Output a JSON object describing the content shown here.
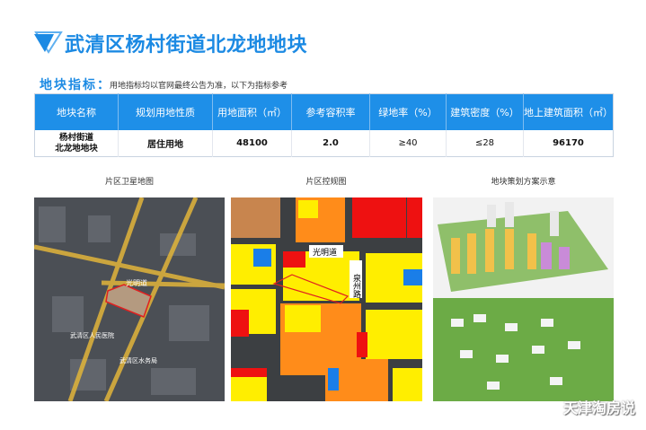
{
  "header": {
    "title": "武清区杨村街道北龙地地块",
    "section_label": "地块指标：",
    "section_note": "用地指标均以官网最终公告为准，以下为指标参考"
  },
  "table": {
    "columns": [
      "地块名称",
      "规划用地性质",
      "用地面积（㎡）",
      "参考容积率",
      "绿地率（%）",
      "建筑密度（%）",
      "地上建筑面积（㎡）"
    ],
    "rows": [
      {
        "name_line1": "杨村街道",
        "name_line2": "北龙地地块",
        "use": "居住用地",
        "area": "48100",
        "far": "2.0",
        "green": "≥40",
        "density": "≤28",
        "gfa": "96170"
      }
    ]
  },
  "images": {
    "satellite": {
      "caption": "片区卫星地图",
      "labels": {
        "road": "光明道",
        "poi1": "武清区人民医院",
        "poi2": "武清区水务局"
      }
    },
    "zoning": {
      "caption": "片区控规图",
      "labels": {
        "road1": "光明道",
        "road2": "泉州路"
      }
    },
    "plan": {
      "caption": "地块策划方案示意"
    }
  },
  "watermark": "天津淘房说",
  "colors": {
    "accent": "#1c8ae3",
    "header_bg": "#1e8fe8"
  }
}
